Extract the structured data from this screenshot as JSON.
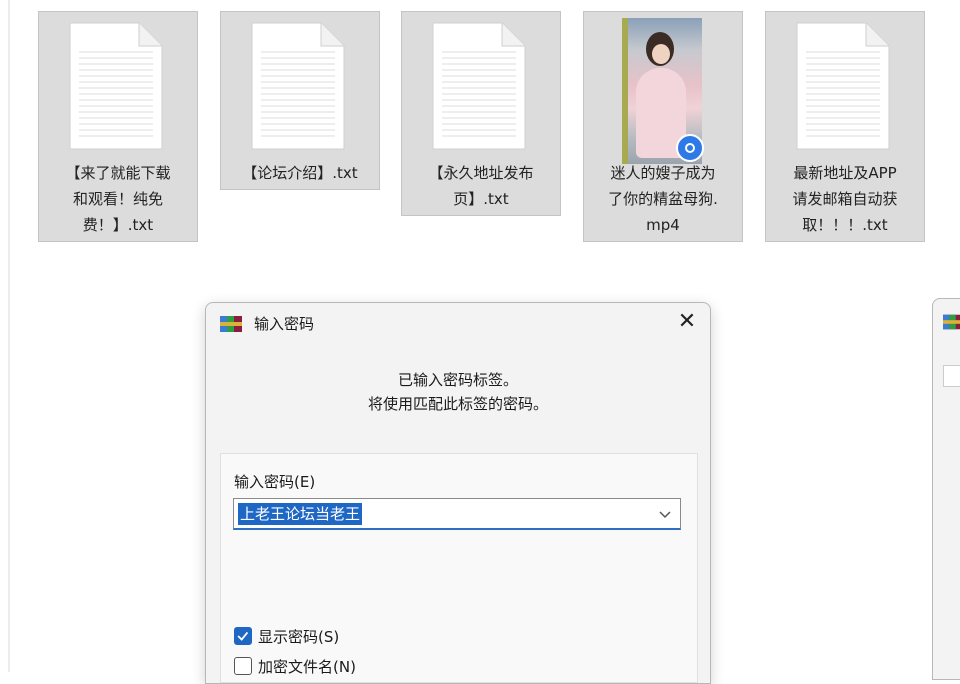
{
  "files": [
    {
      "name": "【来了就能下载和观看！纯免费！】.txt",
      "lines": [
        "【来了就能下载",
        "和观看！纯免",
        "费！】.txt"
      ],
      "type": "txt"
    },
    {
      "name": "【论坛介绍】.txt",
      "lines": [
        "【论坛介绍】.txt"
      ],
      "type": "txt"
    },
    {
      "name": "【永久地址发布页】.txt",
      "lines": [
        "【永久地址发布",
        "页】.txt"
      ],
      "type": "txt"
    },
    {
      "name": "迷人的嫂子成为了你的精盆母狗.mp4",
      "lines": [
        "迷人的嫂子成为",
        "了你的精盆母狗.",
        "mp4"
      ],
      "type": "mp4"
    },
    {
      "name": "最新地址及APP请发邮箱自动获取！！！.txt",
      "lines": [
        "最新地址及APP",
        "请发邮箱自动获",
        "取！！！.txt"
      ],
      "type": "txt"
    }
  ],
  "dialog": {
    "title": "输入密码",
    "close_icon": "close-icon",
    "message_line1": "已输入密码标签。",
    "message_line2": "将使用匹配此标签的密码。",
    "password_label": "输入密码(E)",
    "password_value": "上老王论坛当老王",
    "show_password_label": "显示密码(S)",
    "show_password_checked": true,
    "encrypt_names_label": "加密文件名(N)",
    "encrypt_names_checked": false
  },
  "colors": {
    "accent": "#1f67c4",
    "tile_bg": "#dcdcdc",
    "dialog_bg": "#f3f3f3"
  }
}
